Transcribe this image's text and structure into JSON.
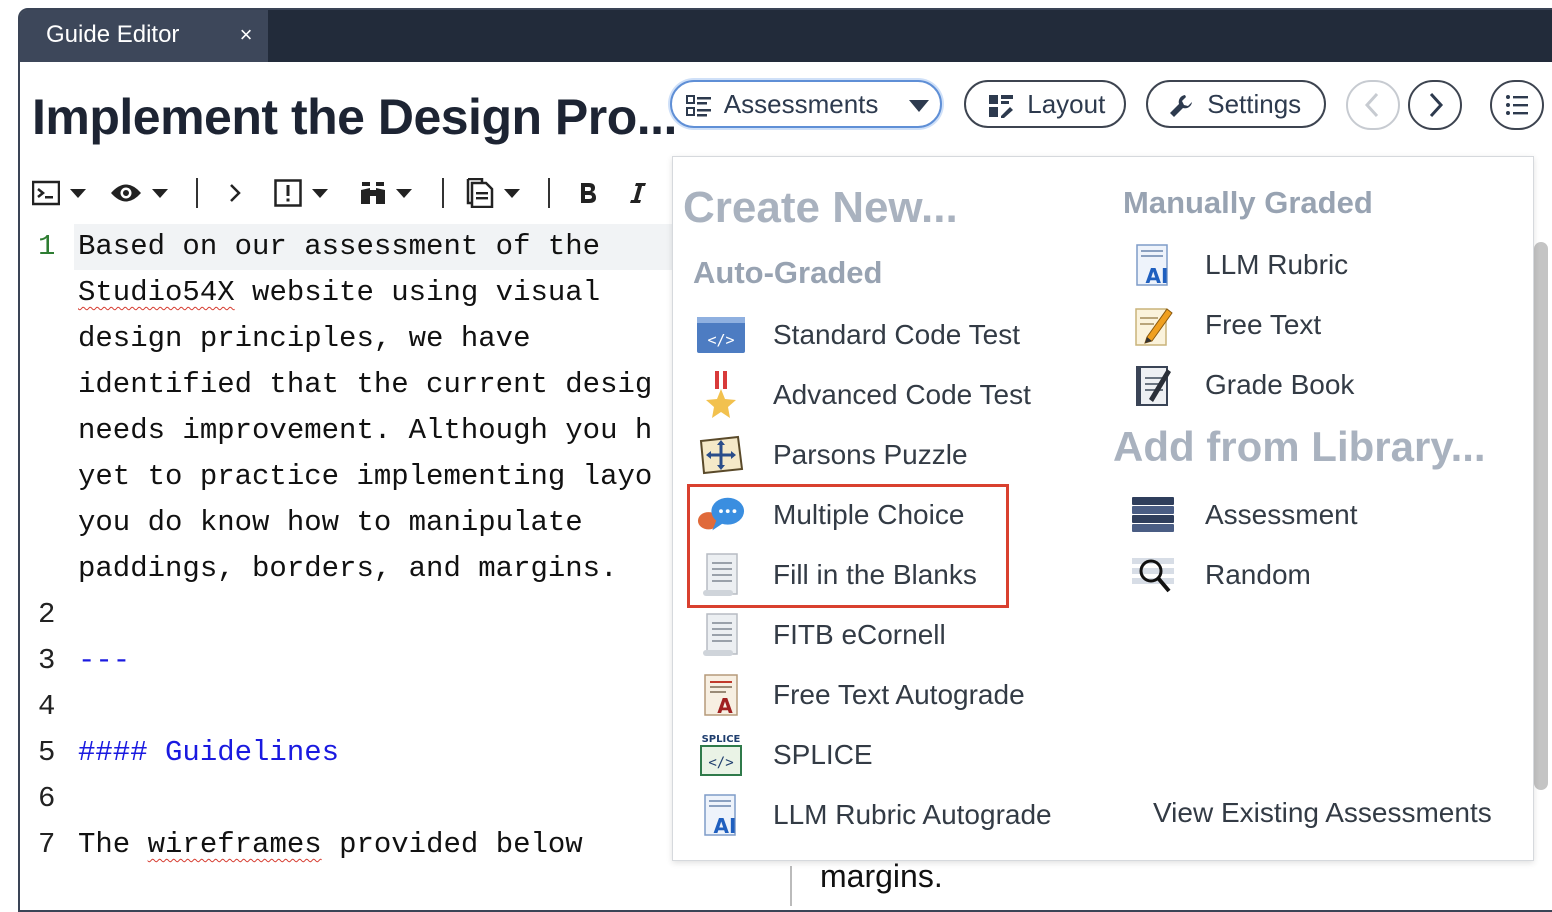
{
  "tab": {
    "title": "Guide Editor",
    "close": "×"
  },
  "page": {
    "title": "Implement the Design Pro..."
  },
  "header": {
    "assessments_label": "Assessments",
    "layout_label": "Layout",
    "settings_label": "Settings"
  },
  "editor": {
    "lines": [
      {
        "num": "1",
        "text": "Based on our assessment of the"
      },
      {
        "num": "",
        "text": "website using visual",
        "prefix": "Studio54X"
      },
      {
        "num": "",
        "text": "design principles, we have"
      },
      {
        "num": "",
        "text": "identified that the current desig"
      },
      {
        "num": "",
        "text": "needs improvement. Although you h"
      },
      {
        "num": "",
        "text": "yet to practice implementing layo"
      },
      {
        "num": "",
        "text": "you do know how to manipulate"
      },
      {
        "num": "",
        "text": "paddings, borders, and margins."
      },
      {
        "num": "2",
        "text": ""
      },
      {
        "num": "3",
        "text": "---"
      },
      {
        "num": "4",
        "text": ""
      },
      {
        "num": "5",
        "text": "#### Guidelines"
      },
      {
        "num": "6",
        "text": ""
      },
      {
        "num": "7",
        "text": "provided below",
        "prefix": "The ",
        "squig": "wireframes"
      }
    ],
    "partial_text": "margins."
  },
  "dropdown": {
    "create_new": "Create New...",
    "auto_graded": "Auto-Graded",
    "manually_graded": "Manually Graded",
    "add_from_library": "Add from Library...",
    "auto_items": [
      "Standard Code Test",
      "Advanced Code Test",
      "Parsons Puzzle",
      "Multiple Choice",
      "Fill in the Blanks",
      "FITB eCornell",
      "Free Text Autograde",
      "SPLICE",
      "LLM Rubric Autograde"
    ],
    "manual_items": [
      "LLM Rubric",
      "Free Text",
      "Grade Book"
    ],
    "library_items": [
      "Assessment",
      "Random"
    ],
    "view_existing": "View Existing Assessments",
    "icon_text": {
      "code": "</>",
      "splice": "SPLICE",
      "ai": "AI",
      "a": "A"
    }
  },
  "colors": {
    "accent": "#5f8fd6",
    "highlight": "#d9402f",
    "section_heading": "#98a3b2",
    "tabbar": "#222b3a"
  }
}
